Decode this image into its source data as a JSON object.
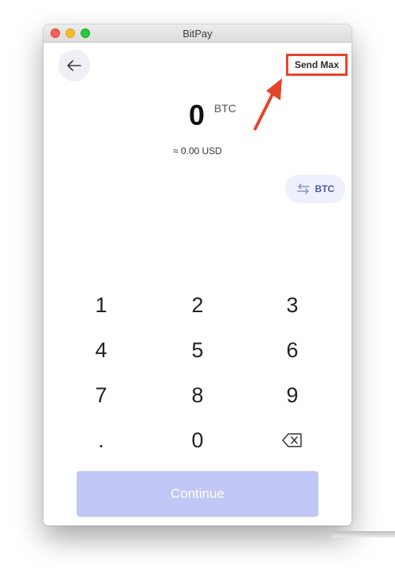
{
  "window": {
    "title": "BitPay"
  },
  "header": {
    "send_max_label": "Send Max",
    "back_icon": "arrow-left-icon"
  },
  "amount": {
    "value": "0",
    "unit": "BTC",
    "fiat_equivalent": "≈ 0.00 USD"
  },
  "currency_toggle": {
    "label": "BTC",
    "icon": "swap-arrows-icon"
  },
  "keypad": {
    "row1": [
      "1",
      "2",
      "3"
    ],
    "row2": [
      "4",
      "5",
      "6"
    ],
    "row3": [
      "7",
      "8",
      "9"
    ],
    "row4": [
      ".",
      "0"
    ],
    "backspace_icon": "backspace-icon"
  },
  "footer": {
    "continue_label": "Continue"
  },
  "colors": {
    "accent": "#4a5aa8",
    "continue_disabled": "#c1c8f6",
    "annotation": "#e6442a"
  }
}
